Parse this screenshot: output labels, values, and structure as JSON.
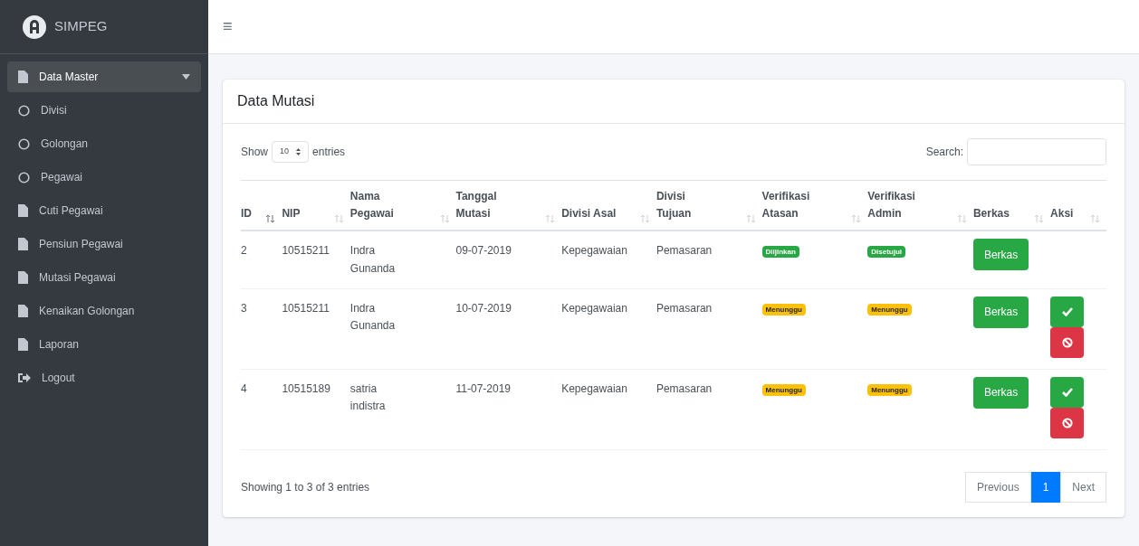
{
  "brand": "SIMPEG",
  "sidebar": {
    "items": [
      {
        "label": "Data Master",
        "kind": "file",
        "selected": true,
        "expanded": true,
        "children": [
          {
            "label": "Divisi",
            "kind": "circle",
            "selected": false
          },
          {
            "label": "Golongan",
            "kind": "circle",
            "selected": false
          },
          {
            "label": "Pegawai",
            "kind": "circle",
            "selected": false
          }
        ]
      },
      {
        "label": "Cuti Pegawai",
        "kind": "file",
        "selected": false
      },
      {
        "label": "Pensiun Pegawai",
        "kind": "file",
        "selected": false
      },
      {
        "label": "Mutasi Pegawai",
        "kind": "file",
        "selected": false
      },
      {
        "label": "Kenaikan Golongan",
        "kind": "file",
        "selected": false
      },
      {
        "label": "Laporan",
        "kind": "file",
        "selected": false
      },
      {
        "label": "Logout",
        "kind": "logout",
        "selected": false
      }
    ]
  },
  "menu_toggle": "≡",
  "card": {
    "title": "Data Mutasi",
    "length": {
      "before": "Show",
      "value": "10",
      "after": "entries"
    },
    "search": {
      "label": "Search:"
    },
    "table": {
      "columns": [
        {
          "label": "ID",
          "sorted": true
        },
        {
          "label": "NIP",
          "sorted": false
        },
        {
          "label": "Nama Pegawai",
          "sorted": false
        },
        {
          "label": "Tanggal Mutasi",
          "sorted": false
        },
        {
          "label": "Divisi Asal",
          "sorted": false
        },
        {
          "label": "Divisi Tujuan",
          "sorted": false
        },
        {
          "label": "Verifikasi Atasan",
          "sorted": false
        },
        {
          "label": "Verifikasi Admin",
          "sorted": false
        },
        {
          "label": "Berkas",
          "sorted": false
        },
        {
          "label": "Aksi",
          "sorted": false
        }
      ],
      "rows": [
        {
          "id": "2",
          "nip": "10515211",
          "nama": "Indra Gunanda",
          "tanggal": "09-07-2019",
          "asal": "Kepegawaian",
          "tujuan": "Pemasaran",
          "atasan": {
            "text": "Diijinkan",
            "kind": "approved"
          },
          "admin": {
            "text": "Disetujui",
            "kind": "approved"
          },
          "berkas": "Berkas",
          "actions": false
        },
        {
          "id": "3",
          "nip": "10515211",
          "nama": "Indra Gunanda",
          "tanggal": "10-07-2019",
          "asal": "Kepegawaian",
          "tujuan": "Pemasaran",
          "atasan": {
            "text": "Menunggu",
            "kind": "waiting"
          },
          "admin": {
            "text": "Menunggu",
            "kind": "waiting"
          },
          "berkas": "Berkas",
          "actions": true
        },
        {
          "id": "4",
          "nip": "10515189",
          "nama": "satria indistra",
          "tanggal": "11-07-2019",
          "asal": "Kepegawaian",
          "tujuan": "Pemasaran",
          "atasan": {
            "text": "Menunggu",
            "kind": "waiting"
          },
          "admin": {
            "text": "Menunggu",
            "kind": "waiting"
          },
          "berkas": "Berkas",
          "actions": true
        }
      ]
    },
    "info": "Showing 1 to 3 of 3 entries",
    "pagination": [
      {
        "label": "Previous",
        "selected": false
      },
      {
        "label": "1",
        "selected": true
      },
      {
        "label": "Next",
        "selected": false
      }
    ]
  }
}
